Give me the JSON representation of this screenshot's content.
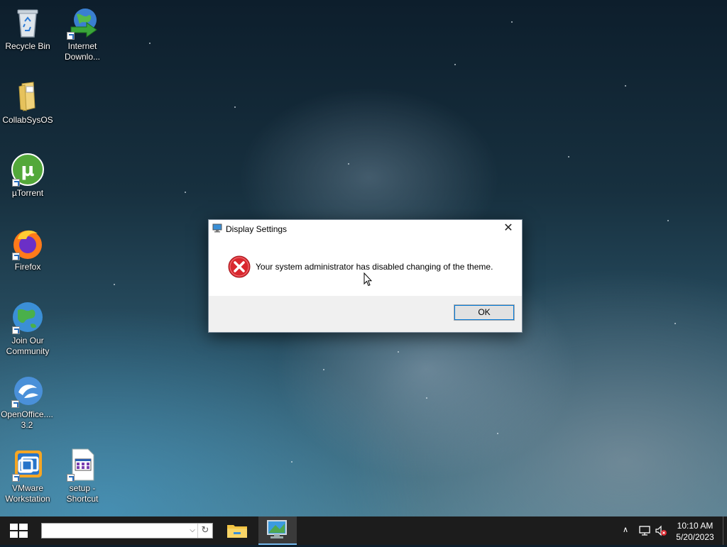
{
  "desktop": {
    "icons": [
      {
        "label_line1": "Recycle Bin",
        "label_line2": "",
        "icon": "recycle-bin-icon"
      },
      {
        "label_line1": "Internet",
        "label_line2": "Downlo...",
        "icon": "internet-download-manager-icon"
      },
      {
        "label_line1": "CollabSysOS",
        "label_line2": "",
        "icon": "folder-icon"
      },
      {
        "label_line1": "µTorrent",
        "label_line2": "",
        "icon": "utorrent-icon"
      },
      {
        "label_line1": "Firefox",
        "label_line2": "",
        "icon": "firefox-icon"
      },
      {
        "label_line1": "Join Our",
        "label_line2": "Community",
        "icon": "globe-icon"
      },
      {
        "label_line1": "OpenOffice....",
        "label_line2": "3.2",
        "icon": "openoffice-icon"
      },
      {
        "label_line1": "VMware",
        "label_line2": "Workstation",
        "icon": "vmware-icon"
      },
      {
        "label_line1": "setup -",
        "label_line2": "Shortcut",
        "icon": "setup-file-icon"
      }
    ]
  },
  "dialog": {
    "title": "Display Settings",
    "close_glyph": "✕",
    "message": "Your system administrator has disabled changing of the theme.",
    "ok_label": "OK",
    "icon": "error-icon"
  },
  "taskbar": {
    "search": {
      "value": "",
      "placeholder": ""
    },
    "pinned": [
      {
        "name": "file-explorer",
        "icon": "folder-icon",
        "active": false
      },
      {
        "name": "display-settings",
        "icon": "monitor-icon",
        "active": true
      }
    ],
    "clock": {
      "time": "10:10 AM",
      "date": "5/20/2023"
    },
    "tray": {
      "overflow_glyph": "∧"
    }
  },
  "colors": {
    "accent": "#0078d7",
    "error_red": "#d9272e",
    "taskbar_bg": "#1c1c1c"
  }
}
